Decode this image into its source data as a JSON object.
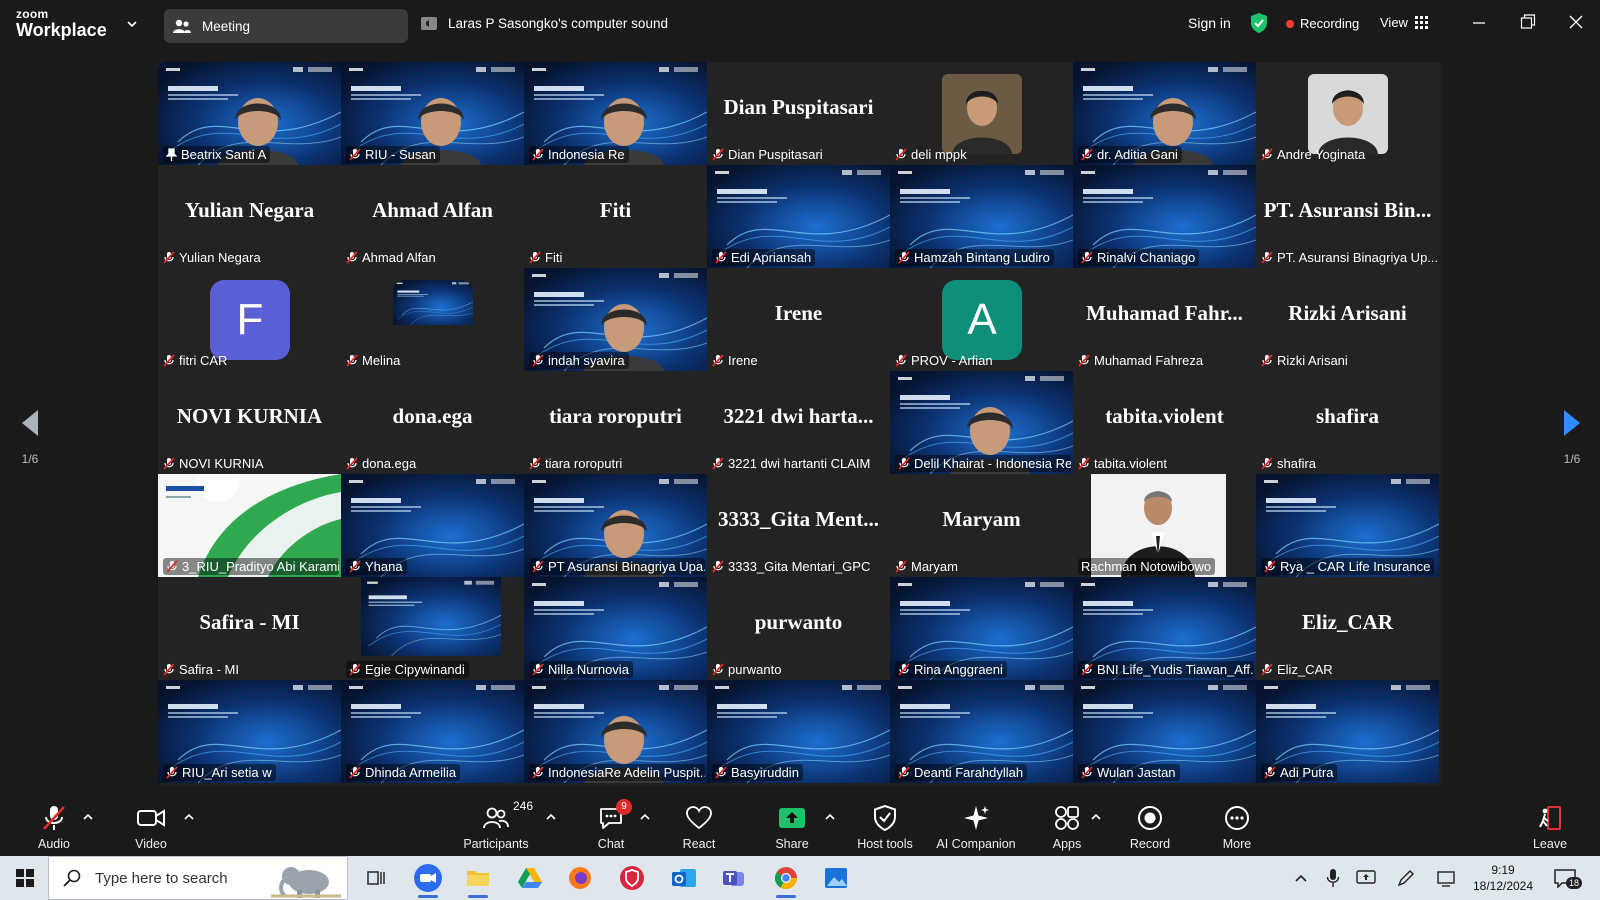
{
  "topbar": {
    "logo_line1": "zoom",
    "logo_line2": "Workplace",
    "meeting_label": "Meeting",
    "sound_label": "Laras P Sasongko's computer sound",
    "signin": "Sign in",
    "recording": "Recording",
    "view": "View"
  },
  "nav": {
    "page_indicator": "1/6"
  },
  "tiles": [
    [
      "Beatrix Santi A",
      "RIU - Susan",
      "Indonesia Re",
      "Dian Puspitasari",
      "deli mppk",
      "dr. Aditia Gani",
      "Andre Yoginata"
    ],
    [
      "Yulian Negara",
      "Ahmad Alfan",
      "Fiti",
      "Edi Apriansah",
      "Hamzah Bintang Ludiro",
      "Rinalvi Chaniago",
      "PT. Asuransi Binagriya Up..."
    ],
    [
      "fitri CAR",
      "Melina",
      "indah syavira",
      "Irene",
      "PROV - Arfian",
      "Muhamad Fahreza",
      "Rizki Arisani"
    ],
    [
      "NOVI KURNIA",
      "dona.ega",
      "tiara roroputri",
      "3221 dwi hartanti CLAIM",
      "Delil Khairat - Indonesia Re",
      "tabita.violent",
      "shafira"
    ],
    [
      "3_RIU_Pradityo Abi Karami",
      "Yhana",
      "PT Asuransi Binagriya Upa...",
      "3333_Gita Mentari_GPC",
      "Maryam",
      "Rachman Notowibowo",
      "Rya _ CAR Life Insurance"
    ],
    [
      "Safira - MI",
      "Egie Cipywinandi",
      "Nilla Nurnovia",
      "purwanto",
      "Rina Anggraeni",
      "BNI Life_Yudis Tiawan_Aff...",
      "Eliz_CAR"
    ],
    [
      "RIU_Ari setia w",
      "Dhinda Armeilia",
      "IndonesiaRe Adelin Puspit...",
      "Basyiruddin",
      "Deanti Farahdyllah",
      "Wulan Jastan",
      "Adi Putra"
    ]
  ],
  "big_names": {
    "dian": "Dian Puspitasari",
    "yulian": "Yulian Negara",
    "ahmad": "Ahmad Alfan",
    "fiti": "Fiti",
    "pt_asuransi": "PT. Asuransi Bin...",
    "irene": "Irene",
    "muhamad": "Muhamad Fahr...",
    "rizki": "Rizki Arisani",
    "novi": "NOVI KURNIA",
    "dona": "dona.ega",
    "tiara": "tiara roroputri",
    "dwi": "3221 dwi harta...",
    "tabita": "tabita.violent",
    "shafira": "shafira",
    "gita": "3333_Gita Ment...",
    "maryam": "Maryam",
    "safira": "Safira - MI",
    "purwanto": "purwanto",
    "eliz": "Eliz_CAR"
  },
  "avatars": {
    "fitri": "F",
    "arfian": "A"
  },
  "toolbar": {
    "audio": "Audio",
    "video": "Video",
    "participants": "Participants",
    "participants_count": "246",
    "chat": "Chat",
    "chat_badge": "9",
    "react": "React",
    "share": "Share",
    "host_tools": "Host tools",
    "ai_companion": "AI Companion",
    "apps": "Apps",
    "record": "Record",
    "more": "More",
    "leave": "Leave"
  },
  "taskbar": {
    "search_placeholder": "Type here to search",
    "time": "9:19",
    "date": "18/12/2024",
    "notifications": "18"
  },
  "colors": {
    "speaking_border": "#3ed07f",
    "share_green": "#1fc16b",
    "recording_red": "#ff3b3b",
    "leave_red": "#e0303a",
    "tile_bg": "#232323"
  }
}
